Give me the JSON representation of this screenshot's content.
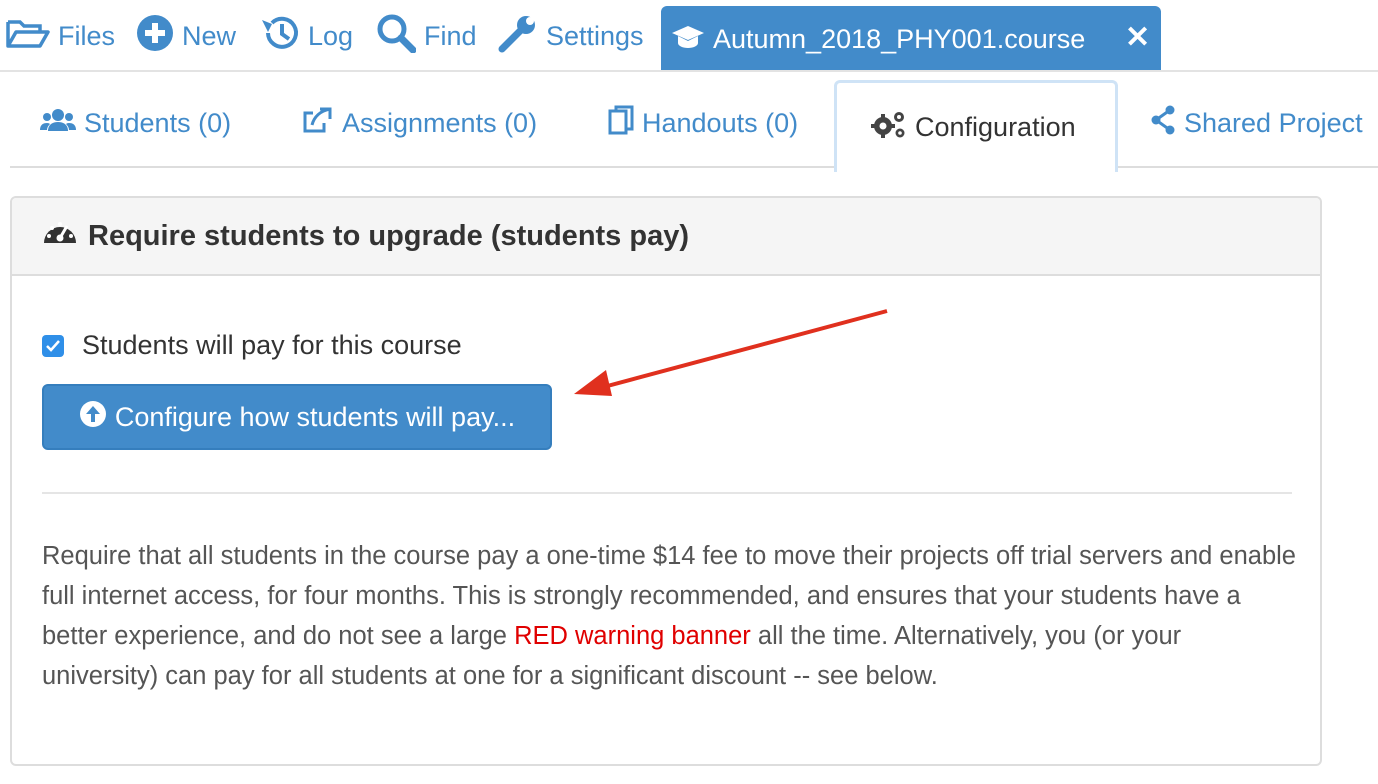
{
  "topbar": {
    "items": [
      {
        "label": "Files",
        "icon": "folder-open-icon"
      },
      {
        "label": "New",
        "icon": "plus-circle-icon"
      },
      {
        "label": "Log",
        "icon": "history-icon"
      },
      {
        "label": "Find",
        "icon": "search-icon"
      },
      {
        "label": "Settings",
        "icon": "wrench-icon"
      }
    ],
    "file_tab": {
      "label": "Autumn_2018_PHY001.course",
      "icon": "graduation-cap-icon",
      "close": "✕"
    },
    "accent": "#428bca"
  },
  "tabs": [
    {
      "label": "Students (0)",
      "icon": "users-icon"
    },
    {
      "label": "Assignments (0)",
      "icon": "share-square-icon"
    },
    {
      "label": "Handouts (0)",
      "icon": "copy-icon"
    },
    {
      "label": "Configuration",
      "icon": "cogs-icon",
      "active": true
    },
    {
      "label": "Shared Project",
      "icon": "share-nodes-icon"
    }
  ],
  "panel": {
    "title": "Require students to upgrade (students pay)",
    "title_icon": "dashboard-icon",
    "checkbox_label": "Students will pay for this course",
    "checkbox_checked": true,
    "button_label": "Configure how students will pay...",
    "button_icon": "arrow-circle-up-icon",
    "description_before": "Require that all students in the course pay a one-time $14 fee to move their projects off trial servers and enable full internet access, for four months. This is strongly recommended, and ensures that your students have a better experience, and do not see a large ",
    "description_red": "RED warning banner",
    "description_after": " all the time. Alternatively, you (or your university) can pay for all students at one for a significant discount -- see below."
  }
}
